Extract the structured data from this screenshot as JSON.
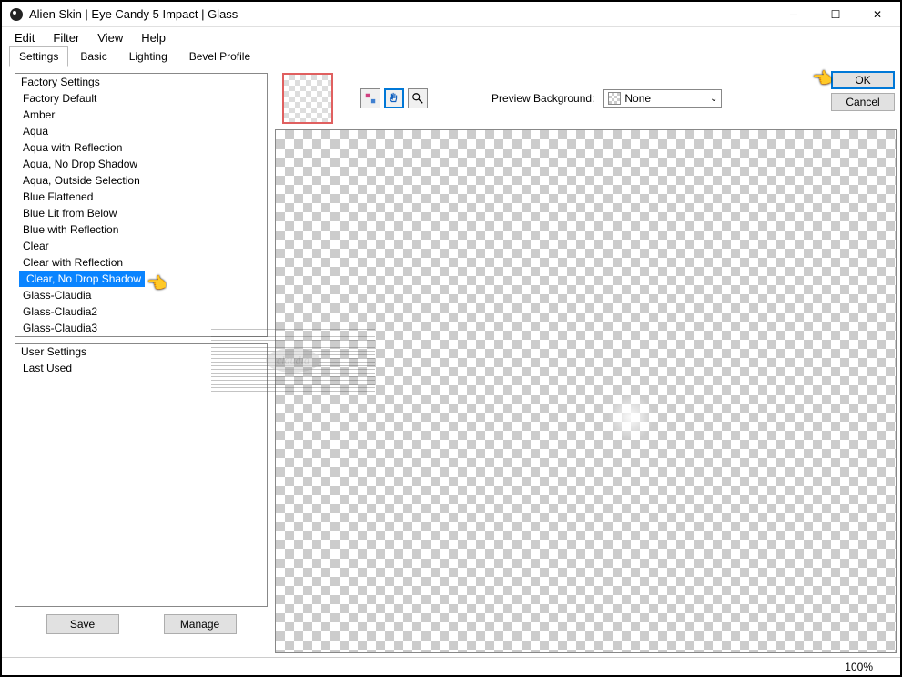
{
  "window": {
    "title": "Alien Skin | Eye Candy 5 Impact | Glass"
  },
  "menubar": {
    "items": [
      "Edit",
      "Filter",
      "View",
      "Help"
    ]
  },
  "tabs": {
    "items": [
      "Settings",
      "Basic",
      "Lighting",
      "Bevel Profile"
    ],
    "active": 0
  },
  "factory_list": {
    "header": "Factory Settings",
    "items": [
      "Factory Default",
      "Amber",
      "Aqua",
      "Aqua with Reflection",
      "Aqua, No Drop Shadow",
      "Aqua, Outside Selection",
      "Blue Flattened",
      "Blue Lit from Below",
      "Blue with Reflection",
      "Clear",
      "Clear with Reflection",
      "Clear, No Drop Shadow",
      "Glass-Claudia",
      "Glass-Claudia2",
      "Glass-Claudia3"
    ],
    "selected_index": 11
  },
  "user_list": {
    "header": "User Settings",
    "items": [
      "Last Used"
    ]
  },
  "buttons": {
    "save": "Save",
    "manage": "Manage",
    "ok": "OK",
    "cancel": "Cancel"
  },
  "preview": {
    "bg_label": "Preview Background:",
    "bg_value": "None"
  },
  "status": {
    "zoom": "100%"
  },
  "watermark": "claudia"
}
